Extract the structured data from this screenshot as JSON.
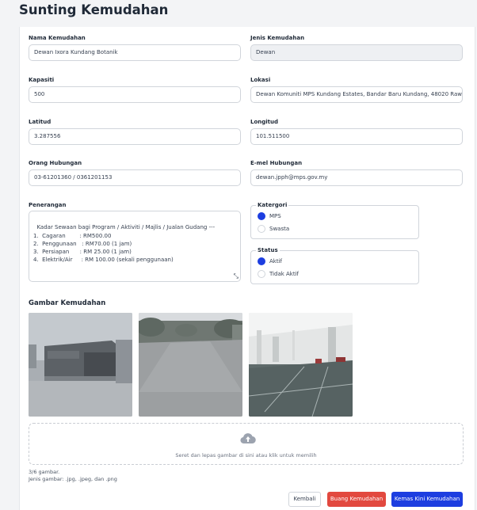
{
  "page": {
    "title": "Sunting Kemudahan"
  },
  "form": {
    "nama_label": "Nama Kemudahan",
    "nama_value": "Dewan Ixora Kundang Botanik",
    "jenis_label": "Jenis Kemudahan",
    "jenis_value": "Dewan",
    "kapasiti_label": "Kapasiti",
    "kapasiti_value": "500",
    "lokasi_label": "Lokasi",
    "lokasi_value": "Dewan Komuniti MPS Kundang Estates, Bandar Baru Kundang, 48020 Rawang, Selangor",
    "latitud_label": "Latitud",
    "latitud_value": "3.287556",
    "longitud_label": "Longitud",
    "longitud_value": "101.511500",
    "orang_label": "Orang Hubungan",
    "orang_value": "03-61201360 / 0361201153",
    "email_label": "E-mel Hubungan",
    "email_value": "dewan.jpph@mps.gov.my",
    "penerangan_label": "Penerangan",
    "penerangan_value": "Kadar Sewaan bagi Program / Aktiviti / Majlis / Jualan Gudang ---\n1.  Cagaran        : RM500.00\n2.  Penggunaan   : RM70.00 (1 jam)\n3.  Persiapan      : RM 25.00 (1 jam)\n4.  Elektrik/Air     : RM 100.00 (sekali penggunaan)"
  },
  "kategori": {
    "label": "Katergori",
    "options": [
      {
        "label": "MPS",
        "selected": true
      },
      {
        "label": "Swasta",
        "selected": false
      }
    ]
  },
  "status": {
    "label": "Status",
    "options": [
      {
        "label": "Aktif",
        "selected": true
      },
      {
        "label": "Tidak Aktif",
        "selected": false
      }
    ]
  },
  "gallery": {
    "title": "Gambar Kemudahan",
    "dropzone_text": "Seret dan lepas gambar di sini atau klik untuk memilih",
    "count_text": "3/6 gambar.",
    "types_text": "Jenis gambar: .jpg, .jpeg, dan .png"
  },
  "actions": {
    "back": "Kembali",
    "delete": "Buang Kemudahan",
    "update": "Kemas Kini Kemudahan"
  },
  "colors": {
    "primary": "#1d3ee0",
    "danger": "#e2493f"
  },
  "icons": {
    "upload": "cloud-upload-icon",
    "resize": "resize-handle-icon"
  }
}
